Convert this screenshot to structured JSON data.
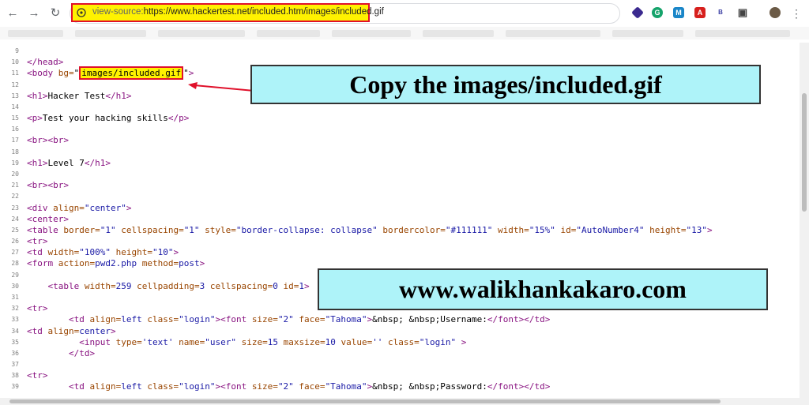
{
  "browser": {
    "url_prefix": "view-source:",
    "url_main": "https://www.hackertest.net/included.htm/images/included.gif"
  },
  "extensions": [
    "hexagon-ext-icon",
    "grammarly-icon",
    "mango-ext-icon",
    "pdf-ext-icon",
    "b-ext-icon",
    "puzzle-icon",
    "avatar"
  ],
  "accent_colors": {
    "highlight": "#fff200",
    "highlight_border": "#e0112b",
    "callout_bg": "#aef3f9"
  },
  "source_lines": [
    {
      "n": "9",
      "parts": []
    },
    {
      "n": "10",
      "parts": [
        {
          "c": "tg",
          "t": "</head>"
        }
      ]
    },
    {
      "n": "11",
      "parts": [
        {
          "c": "tg",
          "t": "<body "
        },
        {
          "c": "at",
          "t": "bg="
        },
        {
          "c": "",
          "t": "\""
        },
        {
          "c": "hl",
          "t": "images/included.gif"
        },
        {
          "c": "",
          "t": "\""
        },
        {
          "c": "tg",
          "t": ">"
        }
      ]
    },
    {
      "n": "12",
      "parts": []
    },
    {
      "n": "13",
      "parts": [
        {
          "c": "tg",
          "t": "<h1>"
        },
        {
          "c": "",
          "t": "Hacker Test"
        },
        {
          "c": "tg",
          "t": "</h1>"
        }
      ]
    },
    {
      "n": "14",
      "parts": []
    },
    {
      "n": "15",
      "parts": [
        {
          "c": "tg",
          "t": "<p>"
        },
        {
          "c": "",
          "t": "Test your hacking skills"
        },
        {
          "c": "tg",
          "t": "</p>"
        }
      ]
    },
    {
      "n": "16",
      "parts": []
    },
    {
      "n": "17",
      "parts": [
        {
          "c": "tg",
          "t": "<br><br>"
        }
      ]
    },
    {
      "n": "18",
      "parts": []
    },
    {
      "n": "19",
      "parts": [
        {
          "c": "tg",
          "t": "<h1>"
        },
        {
          "c": "",
          "t": "Level 7"
        },
        {
          "c": "tg",
          "t": "</h1>"
        }
      ]
    },
    {
      "n": "20",
      "parts": []
    },
    {
      "n": "21",
      "parts": [
        {
          "c": "tg",
          "t": "<br><br>"
        }
      ]
    },
    {
      "n": "22",
      "parts": []
    },
    {
      "n": "23",
      "parts": [
        {
          "c": "tg",
          "t": "<div "
        },
        {
          "c": "at",
          "t": "align="
        },
        {
          "c": "av",
          "t": "\"center\""
        },
        {
          "c": "tg",
          "t": ">"
        }
      ]
    },
    {
      "n": "24",
      "parts": [
        {
          "c": "tg",
          "t": "<center>"
        }
      ]
    },
    {
      "n": "25",
      "parts": [
        {
          "c": "tg",
          "t": "<table "
        },
        {
          "c": "at",
          "t": "border="
        },
        {
          "c": "av",
          "t": "\"1\""
        },
        {
          "c": "at",
          "t": " cellspacing="
        },
        {
          "c": "av",
          "t": "\"1\""
        },
        {
          "c": "at",
          "t": " style="
        },
        {
          "c": "av",
          "t": "\"border-collapse: collapse\""
        },
        {
          "c": "at",
          "t": " bordercolor="
        },
        {
          "c": "av",
          "t": "\"#111111\""
        },
        {
          "c": "at",
          "t": " width="
        },
        {
          "c": "av",
          "t": "\"15%\""
        },
        {
          "c": "at",
          "t": " id="
        },
        {
          "c": "av",
          "t": "\"AutoNumber4\""
        },
        {
          "c": "at",
          "t": " height="
        },
        {
          "c": "av",
          "t": "\"13\""
        },
        {
          "c": "tg",
          "t": ">"
        }
      ]
    },
    {
      "n": "26",
      "parts": [
        {
          "c": "tg",
          "t": "<tr>"
        }
      ]
    },
    {
      "n": "27",
      "parts": [
        {
          "c": "tg",
          "t": "<td "
        },
        {
          "c": "at",
          "t": "width="
        },
        {
          "c": "av",
          "t": "\"100%\""
        },
        {
          "c": "at",
          "t": " height="
        },
        {
          "c": "av",
          "t": "\"10\""
        },
        {
          "c": "tg",
          "t": ">"
        }
      ]
    },
    {
      "n": "28",
      "parts": [
        {
          "c": "tg",
          "t": "<form "
        },
        {
          "c": "at",
          "t": "action="
        },
        {
          "c": "av",
          "t": "pwd2.php"
        },
        {
          "c": "at",
          "t": " method="
        },
        {
          "c": "av",
          "t": "post"
        },
        {
          "c": "tg",
          "t": ">"
        }
      ]
    },
    {
      "n": "29",
      "parts": []
    },
    {
      "n": "30",
      "parts": [
        {
          "c": "",
          "t": "    "
        },
        {
          "c": "tg",
          "t": "<table "
        },
        {
          "c": "at",
          "t": "width="
        },
        {
          "c": "av",
          "t": "259"
        },
        {
          "c": "at",
          "t": " cellpadding="
        },
        {
          "c": "av",
          "t": "3"
        },
        {
          "c": "at",
          "t": " cellspacing="
        },
        {
          "c": "av",
          "t": "0"
        },
        {
          "c": "at",
          "t": " id="
        },
        {
          "c": "av",
          "t": "1"
        },
        {
          "c": "tg",
          "t": ">"
        }
      ]
    },
    {
      "n": "31",
      "parts": []
    },
    {
      "n": "32",
      "parts": [
        {
          "c": "tg",
          "t": "<tr>"
        }
      ]
    },
    {
      "n": "33",
      "parts": [
        {
          "c": "",
          "t": "        "
        },
        {
          "c": "tg",
          "t": "<td "
        },
        {
          "c": "at",
          "t": "align="
        },
        {
          "c": "av",
          "t": "left"
        },
        {
          "c": "at",
          "t": " class="
        },
        {
          "c": "av",
          "t": "\"login\""
        },
        {
          "c": "tg",
          "t": "><font "
        },
        {
          "c": "at",
          "t": "size="
        },
        {
          "c": "av",
          "t": "\"2\""
        },
        {
          "c": "at",
          "t": " face="
        },
        {
          "c": "av",
          "t": "\"Tahoma\""
        },
        {
          "c": "tg",
          "t": ">"
        },
        {
          "c": "",
          "t": "&nbsp; &nbsp;Username:"
        },
        {
          "c": "tg",
          "t": "</font></td>"
        }
      ]
    },
    {
      "n": "34",
      "parts": [
        {
          "c": "tg",
          "t": "<td "
        },
        {
          "c": "at",
          "t": "align="
        },
        {
          "c": "av",
          "t": "center"
        },
        {
          "c": "tg",
          "t": ">"
        }
      ]
    },
    {
      "n": "35",
      "parts": [
        {
          "c": "",
          "t": "          "
        },
        {
          "c": "tg",
          "t": "<input "
        },
        {
          "c": "at",
          "t": "type="
        },
        {
          "c": "av",
          "t": "'text'"
        },
        {
          "c": "at",
          "t": " name="
        },
        {
          "c": "av",
          "t": "\"user\""
        },
        {
          "c": "at",
          "t": " size="
        },
        {
          "c": "av",
          "t": "15"
        },
        {
          "c": "at",
          "t": " maxsize="
        },
        {
          "c": "av",
          "t": "10"
        },
        {
          "c": "at",
          "t": " value="
        },
        {
          "c": "av",
          "t": "''"
        },
        {
          "c": "at",
          "t": " class="
        },
        {
          "c": "av",
          "t": "\"login\""
        },
        {
          "c": "tg",
          "t": " >"
        }
      ]
    },
    {
      "n": "36",
      "parts": [
        {
          "c": "",
          "t": "        "
        },
        {
          "c": "tg",
          "t": "</td>"
        }
      ]
    },
    {
      "n": "37",
      "parts": []
    },
    {
      "n": "38",
      "parts": [
        {
          "c": "tg",
          "t": "<tr>"
        }
      ]
    },
    {
      "n": "39",
      "parts": [
        {
          "c": "",
          "t": "        "
        },
        {
          "c": "tg",
          "t": "<td "
        },
        {
          "c": "at",
          "t": "align="
        },
        {
          "c": "av",
          "t": "left"
        },
        {
          "c": "at",
          "t": " class="
        },
        {
          "c": "av",
          "t": "\"login\""
        },
        {
          "c": "tg",
          "t": "><font "
        },
        {
          "c": "at",
          "t": "size="
        },
        {
          "c": "av",
          "t": "\"2\""
        },
        {
          "c": "at",
          "t": " face="
        },
        {
          "c": "av",
          "t": "\"Tahoma\""
        },
        {
          "c": "tg",
          "t": ">"
        },
        {
          "c": "",
          "t": "&nbsp; &nbsp;Password:"
        },
        {
          "c": "tg",
          "t": "</font></td>"
        }
      ]
    }
  ],
  "callouts": {
    "copy": "Copy the images/included.gif",
    "site": "www.walikhankakaro.com"
  }
}
